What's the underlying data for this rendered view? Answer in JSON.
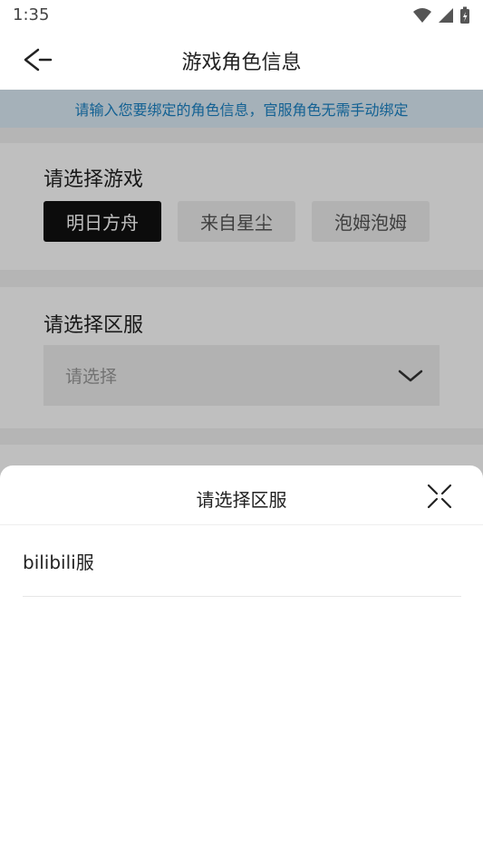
{
  "status_bar": {
    "time": "1:35"
  },
  "nav": {
    "title": "游戏角色信息"
  },
  "notice": {
    "text": "请输入您要绑定的角色信息，官服角色无需手动绑定"
  },
  "game_section": {
    "title": "请选择游戏",
    "games": [
      "明日方舟",
      "来自星尘",
      "泡姆泡姆"
    ],
    "selected": "明日方舟"
  },
  "server_section": {
    "title": "请选择区服",
    "placeholder": "请选择"
  },
  "sheet": {
    "title": "请选择区服",
    "options": [
      "bilibili服"
    ]
  },
  "colors": {
    "notice_bg": "#dcecf7",
    "notice_text": "#1a82c4",
    "chip_active": "#111111",
    "chip_inactive": "#eeeeee"
  }
}
